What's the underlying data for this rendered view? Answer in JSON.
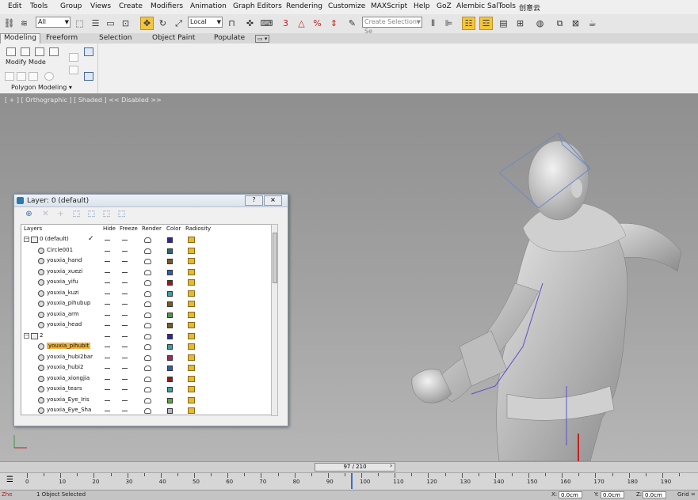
{
  "menu": [
    "Edit",
    "Tools",
    "Group",
    "Views",
    "Create",
    "Modifiers",
    "Animation",
    "Graph Editors",
    "Rendering",
    "Customize",
    "MAXScript",
    "Help",
    "GoZ",
    "Alembic",
    "SalTools",
    "创意云"
  ],
  "toolbar": {
    "selection_filter": "All",
    "ref_coord": "Local",
    "create_selection_set": "Create Selection Se",
    "spinner_value": "3"
  },
  "ribbon": {
    "tabs": [
      "Modeling",
      "Freeform",
      "Selection",
      "Object Paint",
      "Populate"
    ],
    "selected_tab": "Modeling",
    "mode_label": "Modify Mode",
    "panel_label": "Polygon Modeling"
  },
  "viewport": {
    "label": "[ + ] [ Orthographic ] [ Shaded ]  << Disabled >>"
  },
  "layer_dialog": {
    "title": "Layer: 0 (default)",
    "help_btn": "?",
    "close_btn": "×",
    "columns": [
      "Layers",
      "Hide",
      "Freeze",
      "Render",
      "Color",
      "Radiosity"
    ],
    "rows": [
      {
        "name": "0 (default)",
        "type": "layer",
        "expand": "⊟",
        "check": "✓",
        "color": "#2a2a9a"
      },
      {
        "name": "Circle001",
        "type": "object",
        "color": "#1f6f6f"
      },
      {
        "name": "youxia_hand",
        "type": "object",
        "color": "#7a5a20"
      },
      {
        "name": "youxia_xuezi",
        "type": "object",
        "color": "#2f5fa8"
      },
      {
        "name": "youxia_yifu",
        "type": "object",
        "color": "#9a1a1a"
      },
      {
        "name": "youxia_kuzi",
        "type": "object",
        "color": "#3aa0a0"
      },
      {
        "name": "youxia_pihubup",
        "type": "object",
        "color": "#7a5a20"
      },
      {
        "name": "youxia_arm",
        "type": "object",
        "color": "#4a9a40"
      },
      {
        "name": "youxia_head",
        "type": "object",
        "color": "#7a5a20"
      },
      {
        "name": "2",
        "type": "layer",
        "expand": "⊟",
        "color": "#2a2a9a"
      },
      {
        "name": "youxia_pihubit",
        "type": "object",
        "selected": true,
        "color": "#3aa0a0"
      },
      {
        "name": "youxia_hubi2bar",
        "type": "object",
        "color": "#9a2a5a"
      },
      {
        "name": "youxia_hubi2",
        "type": "object",
        "color": "#2f5fa8"
      },
      {
        "name": "youxia_xiongjia",
        "type": "object",
        "color": "#9a1a1a"
      },
      {
        "name": "youxia_tears",
        "type": "object",
        "color": "#3aa0a0"
      },
      {
        "name": "youxia_Eye_Iris",
        "type": "object",
        "color": "#6aa040"
      },
      {
        "name": "youxia_Eye_Sha",
        "type": "object",
        "color": "#b9b9b9"
      }
    ]
  },
  "timeline": {
    "frame_display": "97 / 210",
    "current": 97,
    "total": 210,
    "tick_labels": [
      "0",
      "10",
      "20",
      "30",
      "40",
      "50",
      "60",
      "70",
      "80",
      "90",
      "100",
      "110",
      "120",
      "130",
      "140",
      "150",
      "160",
      "170",
      "180",
      "190"
    ]
  },
  "status": {
    "maxscript_mini": "Zhe",
    "objects_selected": "1 Object Selected",
    "x_label": "X:",
    "x_value": "0.0cm",
    "y_label": "Y:",
    "y_value": "0.0cm",
    "z_label": "Z:",
    "z_value": "0.0cm",
    "grid_label": "Grid ="
  }
}
